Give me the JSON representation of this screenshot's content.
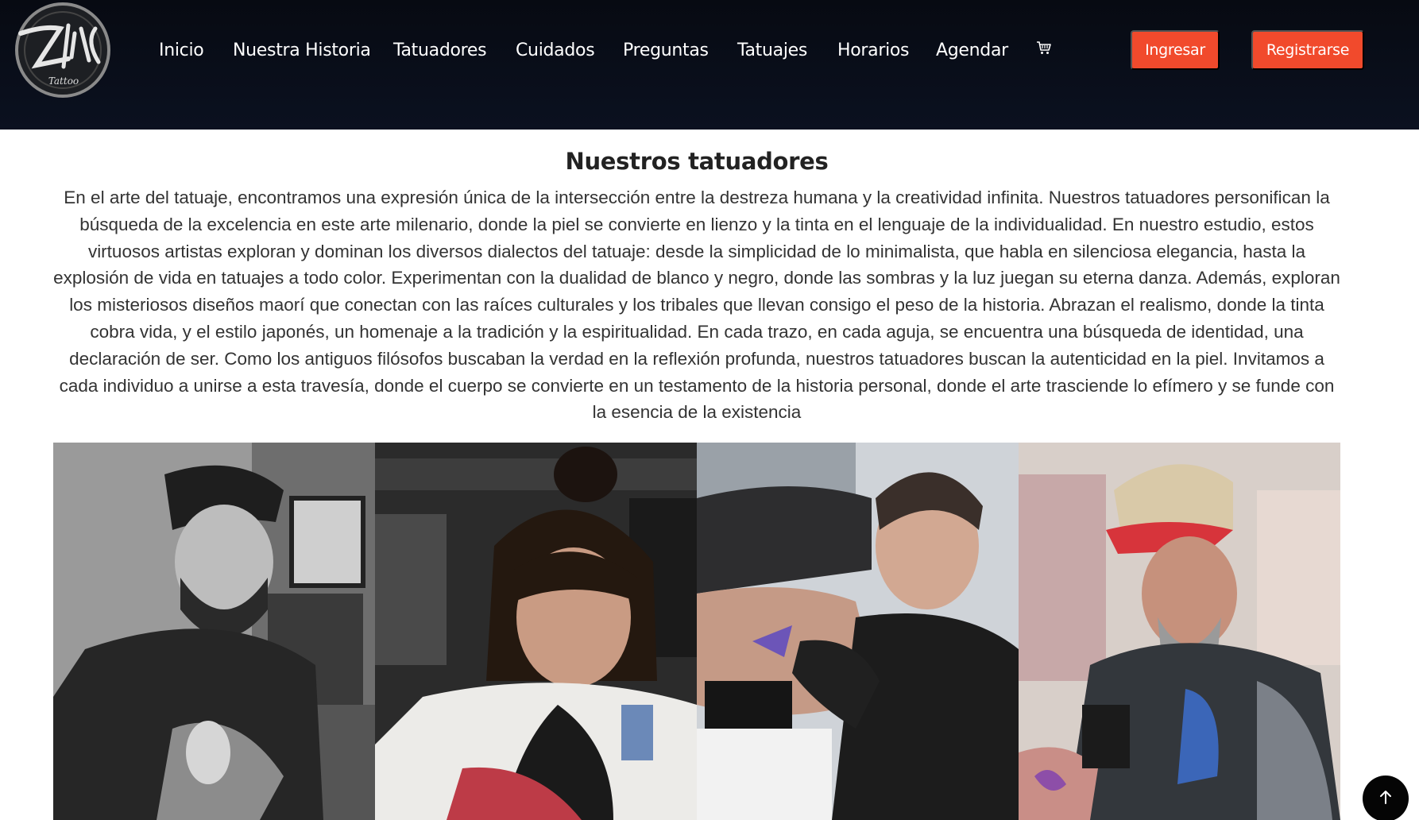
{
  "header": {
    "logo_text": "Ziki",
    "logo_subtext": "Tattoo",
    "nav": [
      {
        "label": "Inicio"
      },
      {
        "label": "Nuestra Historia"
      },
      {
        "label": "Tatuadores"
      },
      {
        "label": "Cuidados"
      },
      {
        "label": "Preguntas"
      },
      {
        "label": "Tatuajes"
      },
      {
        "label": "Horarios"
      },
      {
        "label": "Agendar"
      }
    ],
    "cart_icon": "cart-icon",
    "login_label": "Ingresar",
    "register_label": "Registrarse",
    "accent_color": "#f14a2c",
    "background_color": "#0b1120"
  },
  "main": {
    "title": "Nuestros tatuadores",
    "description": "En el arte del tatuaje, encontramos una expresión única de la intersección entre la destreza humana y la creatividad infinita. Nuestros tatuadores personifican la búsqueda de la excelencia en este arte milenario, donde la piel se convierte en lienzo y la tinta en el lenguaje de la individualidad. En nuestro estudio, estos virtuosos artistas exploran y dominan los diversos dialectos del tatuaje: desde la simplicidad de lo minimalista, que habla en silenciosa elegancia, hasta la explosión de vida en tatuajes a todo color. Experimentan con la dualidad de blanco y negro, donde las sombras y la luz juegan su eterna danza. Además, exploran los misteriosos diseños maorí que conectan con las raíces culturales y los tribales que llevan consigo el peso de la historia. Abrazan el realismo, donde la tinta cobra vida, y el estilo japonés, un homenaje a la tradición y la espiritualidad. En cada trazo, en cada aguja, se encuentra una búsqueda de identidad, una declaración de ser. Como los antiguos filósofos buscaban la verdad en la reflexión profunda, nuestros tatuadores buscan la autenticidad en la piel. Invitamos a cada individuo a unirse a esta travesía, donde el cuerpo se convierte en un testamento de la historia personal, donde el arte trasciende lo efímero y se funde con la esencia de la existencia"
  },
  "scroll_top_icon": "arrow-up-icon"
}
